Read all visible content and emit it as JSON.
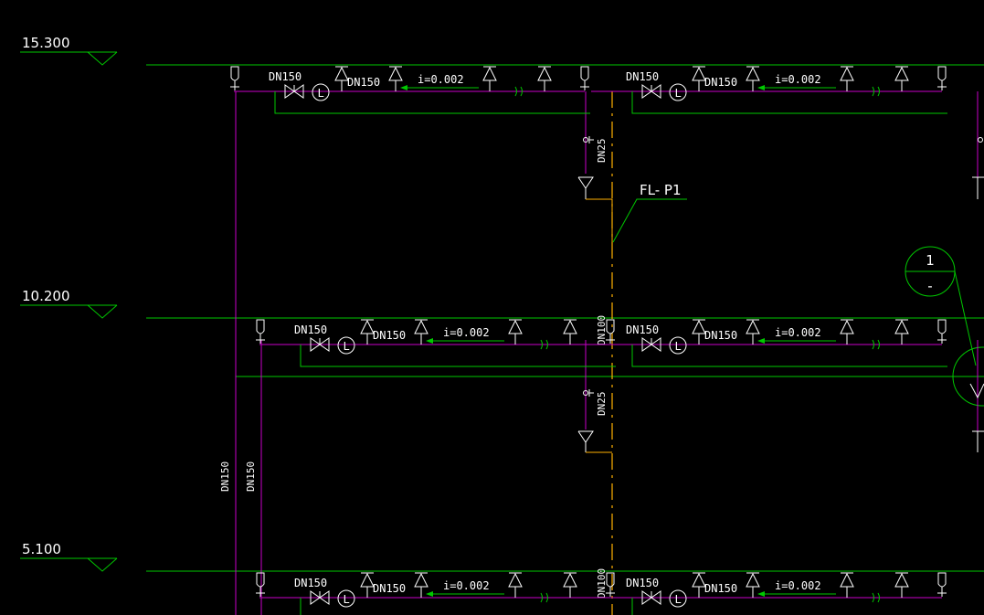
{
  "colors": {
    "background": "#000000",
    "floor_line": "#00c800",
    "pipe": "#c800c8",
    "text": "#ffffff",
    "riser_dash": "#ffb000",
    "leader": "#00c800"
  },
  "elevations": [
    {
      "label": "15.300"
    },
    {
      "label": "10.200"
    },
    {
      "label": "5.100"
    }
  ],
  "pipe_labels": {
    "main_size": "DN150",
    "branch_size": "DN150",
    "slope": "i=0.002",
    "level_gauge": "L",
    "drain_size": "DN25",
    "riser_size": "DN100",
    "left_riser_a": "DN150",
    "left_riser_b": "DN150"
  },
  "riser_tag": {
    "label": "FL- P1"
  },
  "detail_callout": {
    "number": "1",
    "sheet": "-"
  }
}
